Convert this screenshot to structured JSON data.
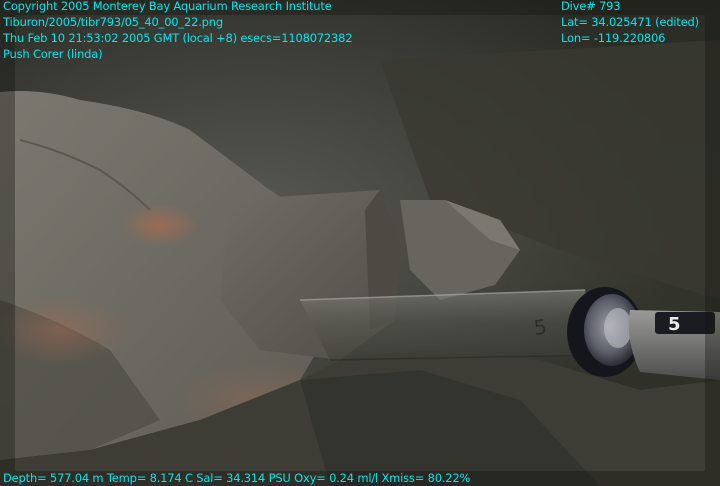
{
  "overlay": {
    "copyright": "Copyright 2005 Monterey Bay Aquarium Research Institute",
    "file": "Tiburon/2005/tibr793/05_40_00_22.png",
    "datetime": "Thu Feb 10 21:53:02 2005 GMT (local +8)  esecs=1108072382",
    "activity": "Push Corer (linda)",
    "dive": "Dive# 793",
    "lat": "Lat= 34.025471 (edited)",
    "lon": "Lon= -119.220806",
    "sensors": "Depth= 577.04 m  Temp= 8.174 C  Sal= 34.314 PSU  Oxy= 0.24 ml/l  Xmiss= 80.22%",
    "text_color": "#00e6f0"
  },
  "scene": {
    "subject": "seafloor boulders with ROV push corer tube",
    "core_tube_label": "5",
    "handle_label": "5",
    "colors": {
      "water": "#2f3129",
      "rock_light": "#76746b",
      "rock_shadow": "#4d4b44",
      "orange_patch": "#9b6a52",
      "sediment": "#3b3b33"
    }
  }
}
